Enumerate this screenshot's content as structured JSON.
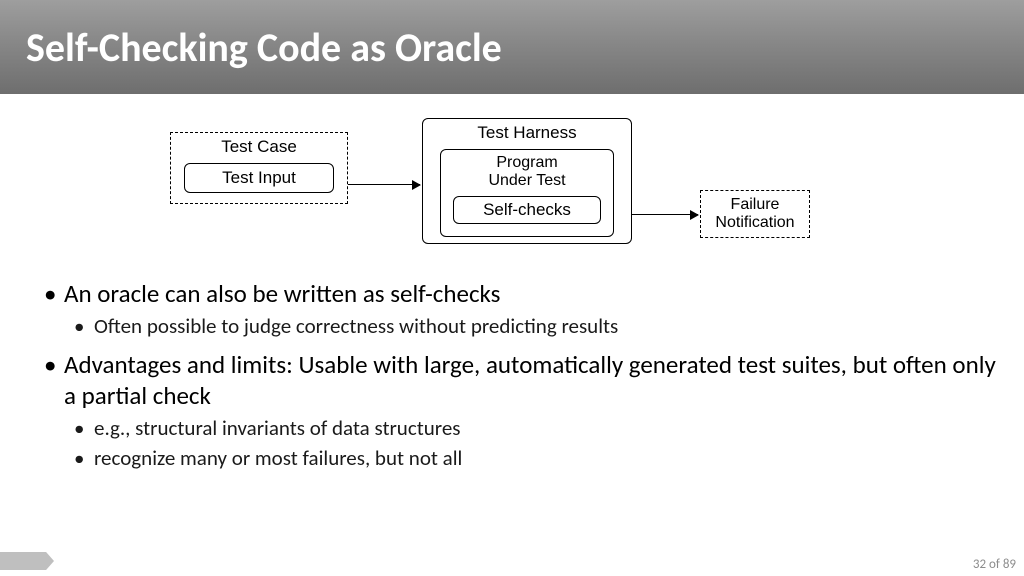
{
  "title": "Self-Checking Code as Oracle",
  "diagram": {
    "test_case_label": "Test Case",
    "test_input_label": "Test Input",
    "harness_label": "Test Harness",
    "program_label": "Program\nUnder Test",
    "self_checks_label": "Self-checks",
    "failure_label": "Failure\nNotification"
  },
  "bullets": {
    "b1": "An oracle can also be written as self-checks",
    "b1_1": "Often possible to judge correctness without predicting results",
    "b2": "Advantages and limits: Usable with large, automatically generated test suites, but often only a partial check",
    "b2_1": "e.g., structural invariants of data structures",
    "b2_2": "recognize many or most failures, but not all"
  },
  "page": {
    "current": "32",
    "sep": " of ",
    "total": "89"
  }
}
